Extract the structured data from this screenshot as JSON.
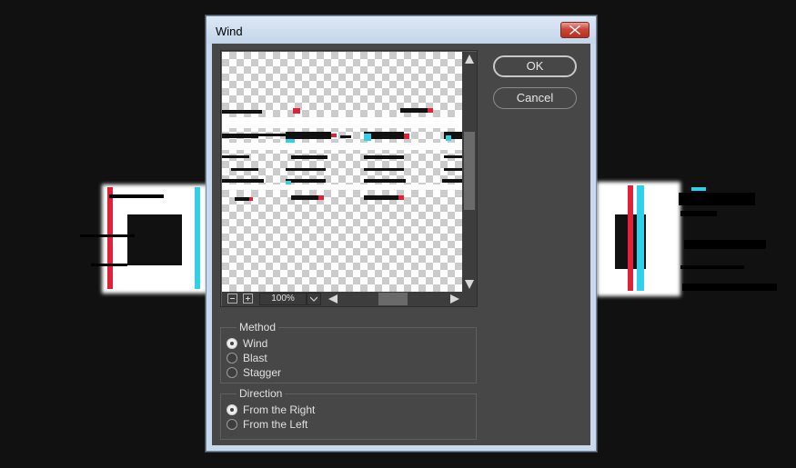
{
  "dialog": {
    "title": "Wind",
    "close_icon": "close-icon"
  },
  "preview": {
    "zoom_level": "100%",
    "zoom_out_icon": "minus-square-icon",
    "zoom_in_icon": "plus-square-icon"
  },
  "buttons": {
    "ok_label": "OK",
    "cancel_label": "Cancel"
  },
  "method": {
    "legend": "Method",
    "options": [
      "Wind",
      "Blast",
      "Stagger"
    ],
    "selected": "Wind"
  },
  "direction": {
    "legend": "Direction",
    "options": [
      "From the Right",
      "From the Left"
    ],
    "selected": "From the Right"
  },
  "colors": {
    "dialog_bg": "#474747",
    "title_bar": "#c9d9ec",
    "close_button": "#c8463a",
    "page_bg": "#111111"
  }
}
